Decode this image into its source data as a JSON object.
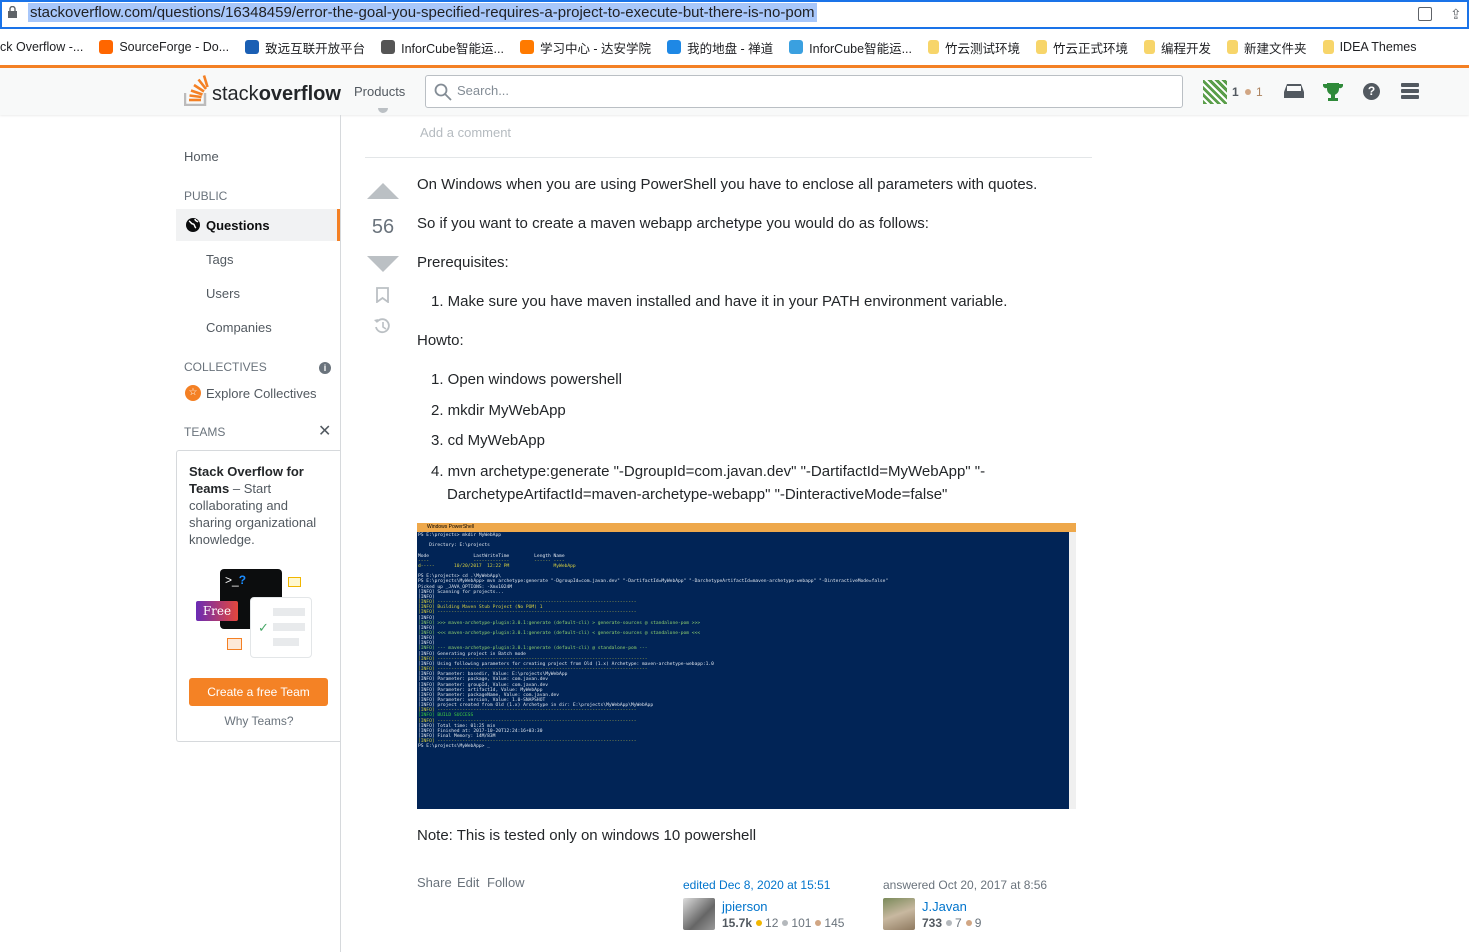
{
  "browser": {
    "url": "stackoverflow.com/questions/16348459/error-the-goal-you-specified-requires-a-project-to-execute-but-there-is-no-pom",
    "bookmarks": [
      {
        "label": "ck Overflow -...",
        "color": ""
      },
      {
        "label": "SourceForge - Do...",
        "color": "#ff6600"
      },
      {
        "label": "致远互联开放平台",
        "color": "#1a5fb4"
      },
      {
        "label": "InforCube智能运...",
        "color": "#555"
      },
      {
        "label": "学习中心 - 达安学院",
        "color": "#ff7a00"
      },
      {
        "label": "我的地盘 - 禅道",
        "color": "#1e88e5"
      },
      {
        "label": "InforCube智能运...",
        "color": "#3aa0e0"
      },
      {
        "label": "竹云测试环境",
        "color": "folder"
      },
      {
        "label": "竹云正式环境",
        "color": "folder"
      },
      {
        "label": "编程开发",
        "color": "folder"
      },
      {
        "label": "新建文件夹",
        "color": "folder"
      },
      {
        "label": "IDEA Themes",
        "color": "folder"
      }
    ]
  },
  "header": {
    "logo_a": "stack",
    "logo_b": "overflow",
    "products": "Products",
    "search_placeholder": "Search...",
    "reputation": "1",
    "bronze": "1"
  },
  "sidebar": {
    "home": "Home",
    "public": "PUBLIC",
    "questions": "Questions",
    "tags": "Tags",
    "users": "Users",
    "companies": "Companies",
    "collectives": "COLLECTIVES",
    "explore": "Explore Collectives",
    "teams": "TEAMS",
    "teams_box": {
      "title": "Stack Overflow for Teams",
      "dash": " – Start collaborating and sharing organizational knowledge.",
      "free": "Free",
      "prompt": ">_",
      "q": "?",
      "cta": "Create a free Team",
      "why": "Why Teams?"
    }
  },
  "main": {
    "add_comment": "Add a comment",
    "votes": "56",
    "p1": "On Windows when you are using PowerShell you have to enclose all parameters with quotes.",
    "p2": "So if you want to create a maven webapp archetype you would do as follows:",
    "p3": "Prerequisites:",
    "pre1": "1. Make sure you have maven installed and have it in your PATH environment variable.",
    "p4": "Howto:",
    "steps": [
      "1. Open windows powershell",
      "2. mkdir MyWebApp",
      "3. cd MyWebApp",
      "4. mvn archetype:generate \"-DgroupId=com.javan.dev\" \"-DartifactId=MyWebApp\" \"-"
    ],
    "step4_cont": "DarchetypeArtifactId=maven-archetype-webapp\" \"-DinteractiveMode=false\"",
    "terminal": {
      "title": "Windows PowerShell",
      "lines": [
        "PS E:\\projects> mkdir MyWebApp",
        "",
        "    Directory: E:\\projects",
        "",
        "Mode                LastWriteTime         Length Name",
        "----                -------------         ------ ----",
        "d-----       10/20/2017  12:22 PM                MyWebApp",
        "",
        "PS E:\\projects> cd .\\MyWebApp\\",
        "PS E:\\projects\\MyWebApp> mvn archetype:generate \"-DgroupId=com.javan.dev\" \"-DartifactId=MyWebApp\" \"-DarchetypeArtifactId=maven-archetype-webapp\" \"-DinteractiveMode=false\"",
        "Picked up _JAVA_OPTIONS: -Xmx1024M",
        "[INFO] Scanning for projects...",
        "[INFO]",
        "[INFO] ------------------------------------------------------------------------",
        "[INFO] Building Maven Stub Project (No POM) 1",
        "[INFO] ------------------------------------------------------------------------",
        "[INFO]",
        "[INFO] >>> maven-archetype-plugin:3.0.1:generate (default-cli) > generate-sources @ standalone-pom >>>",
        "[INFO]",
        "[INFO] <<< maven-archetype-plugin:3.0.1:generate (default-cli) < generate-sources @ standalone-pom <<<",
        "[INFO]",
        "[INFO]",
        "[INFO] --- maven-archetype-plugin:3.0.1:generate (default-cli) @ standalone-pom ---",
        "[INFO] Generating project in Batch mode",
        "[INFO] ----------------------------------------------------------------------------",
        "[INFO] Using following parameters for creating project from Old (1.x) Archetype: maven-archetype-webapp:1.0",
        "[INFO] ----------------------------------------------------------------------------",
        "[INFO] Parameter: basedir, Value: E:\\projects\\MyWebApp",
        "[INFO] Parameter: package, Value: com.javan.dev",
        "[INFO] Parameter: groupId, Value: com.javan.dev",
        "[INFO] Parameter: artifactId, Value: MyWebApp",
        "[INFO] Parameter: packageName, Value: com.javan.dev",
        "[INFO] Parameter: version, Value: 1.0-SNAPSHOT",
        "[INFO] project created from Old (1.x) Archetype in dir: E:\\projects\\MyWebApp\\MyWebApp",
        "[INFO] ------------------------------------------------------------------------",
        "[INFO] BUILD SUCCESS",
        "[INFO] ------------------------------------------------------------------------",
        "[INFO] Total time: 01:25 min",
        "[INFO] Finished at: 2017-10-20T12:24:16+03:30",
        "[INFO] Final Memory: 14M/83M",
        "[INFO] ------------------------------------------------------------------------",
        "PS E:\\projects\\MyWebApp> _"
      ]
    },
    "note": "Note: This is tested only on windows 10 powershell",
    "share": "Share",
    "edit": "Edit",
    "follow": "Follow",
    "edited": {
      "label": "edited Dec 8, 2020 at 15:51",
      "user": "jpierson",
      "rep": "15.7k",
      "gold": "12",
      "silver": "101",
      "bronze": "145"
    },
    "answered": {
      "label": "answered Oct 20, 2017 at 8:56",
      "user": "J.Javan",
      "rep": "733",
      "silver": "7",
      "bronze": "9"
    }
  },
  "colors": {
    "accent": "#f48024",
    "link": "#0074cc",
    "gold": "#f1b600",
    "silver": "#b4b8bc",
    "bronze": "#d1a684"
  }
}
